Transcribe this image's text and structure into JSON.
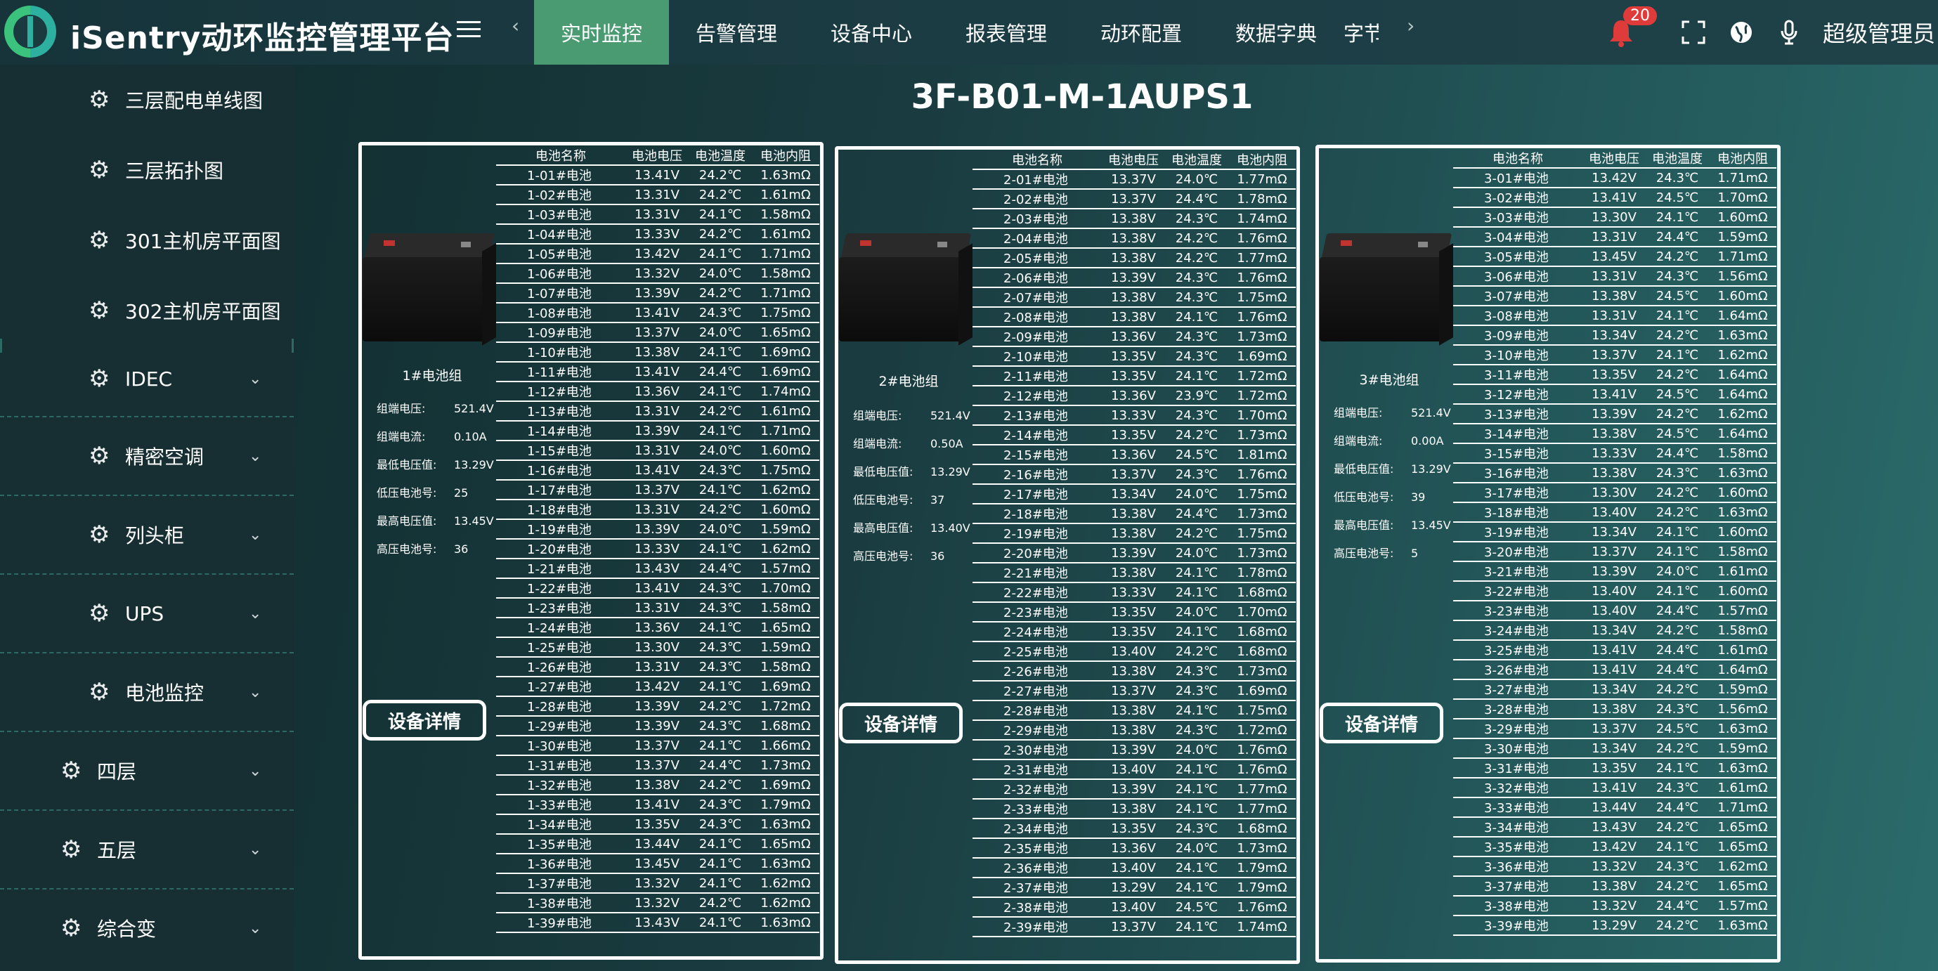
{
  "app": {
    "title": "iSentry动环监控管理平台"
  },
  "nav": {
    "tabs": [
      "实时监控",
      "告警管理",
      "设备中心",
      "报表管理",
      "动环配置",
      "数据字典",
      "字节"
    ],
    "prev": "‹",
    "next": "›"
  },
  "header": {
    "alarm_count": "20",
    "user": "超级管理员"
  },
  "sidebar": {
    "items": [
      {
        "label": "三层配电单线图",
        "expandable": false,
        "level": 2
      },
      {
        "label": "三层拓扑图",
        "expandable": false,
        "level": 2
      },
      {
        "label": "301主机房平面图",
        "expandable": false,
        "level": 2
      },
      {
        "label": "302主机房平面图",
        "expandable": false,
        "level": 2
      },
      {
        "label": "IDEC",
        "expandable": true,
        "level": 2
      },
      {
        "label": "精密空调",
        "expandable": true,
        "level": 2
      },
      {
        "label": "列头柜",
        "expandable": true,
        "level": 2
      },
      {
        "label": "UPS",
        "expandable": true,
        "level": 2
      },
      {
        "label": "电池监控",
        "expandable": true,
        "level": 2
      },
      {
        "label": "四层",
        "expandable": true,
        "level": 1
      },
      {
        "label": "五层",
        "expandable": true,
        "level": 1
      },
      {
        "label": "综合变",
        "expandable": true,
        "level": 1
      }
    ]
  },
  "page": {
    "title": "3F-B01-M-1AUPS1"
  },
  "table_headers": [
    "电池名称",
    "电池电压",
    "电池温度",
    "电池内阻"
  ],
  "detail_label": "设备详情",
  "groups": [
    {
      "name": "1#电池组",
      "info": [
        {
          "k": "组端电压:",
          "v": "521.4V"
        },
        {
          "k": "组端电流:",
          "v": "0.10A"
        },
        {
          "k": "最低电压值:",
          "v": "13.29V"
        },
        {
          "k": "低压电池号:",
          "v": "25"
        },
        {
          "k": "最高电压值:",
          "v": "13.45V"
        },
        {
          "k": "高压电池号:",
          "v": "36"
        }
      ],
      "rows": [
        [
          "1-01#电池",
          "13.41V",
          "24.2℃",
          "1.63mΩ"
        ],
        [
          "1-02#电池",
          "13.31V",
          "24.2℃",
          "1.61mΩ"
        ],
        [
          "1-03#电池",
          "13.31V",
          "24.1℃",
          "1.58mΩ"
        ],
        [
          "1-04#电池",
          "13.33V",
          "24.2℃",
          "1.61mΩ"
        ],
        [
          "1-05#电池",
          "13.42V",
          "24.1℃",
          "1.71mΩ"
        ],
        [
          "1-06#电池",
          "13.32V",
          "24.0℃",
          "1.58mΩ"
        ],
        [
          "1-07#电池",
          "13.39V",
          "24.2℃",
          "1.71mΩ"
        ],
        [
          "1-08#电池",
          "13.41V",
          "24.3℃",
          "1.75mΩ"
        ],
        [
          "1-09#电池",
          "13.37V",
          "24.0℃",
          "1.65mΩ"
        ],
        [
          "1-10#电池",
          "13.38V",
          "24.1℃",
          "1.69mΩ"
        ],
        [
          "1-11#电池",
          "13.41V",
          "24.4℃",
          "1.69mΩ"
        ],
        [
          "1-12#电池",
          "13.36V",
          "24.1℃",
          "1.74mΩ"
        ],
        [
          "1-13#电池",
          "13.31V",
          "24.2℃",
          "1.61mΩ"
        ],
        [
          "1-14#电池",
          "13.39V",
          "24.1℃",
          "1.71mΩ"
        ],
        [
          "1-15#电池",
          "13.31V",
          "24.0℃",
          "1.60mΩ"
        ],
        [
          "1-16#电池",
          "13.41V",
          "24.3℃",
          "1.75mΩ"
        ],
        [
          "1-17#电池",
          "13.37V",
          "24.1℃",
          "1.62mΩ"
        ],
        [
          "1-18#电池",
          "13.31V",
          "24.2℃",
          "1.60mΩ"
        ],
        [
          "1-19#电池",
          "13.39V",
          "24.0℃",
          "1.59mΩ"
        ],
        [
          "1-20#电池",
          "13.33V",
          "24.1℃",
          "1.62mΩ"
        ],
        [
          "1-21#电池",
          "13.43V",
          "24.4℃",
          "1.57mΩ"
        ],
        [
          "1-22#电池",
          "13.41V",
          "24.3℃",
          "1.70mΩ"
        ],
        [
          "1-23#电池",
          "13.31V",
          "24.3℃",
          "1.58mΩ"
        ],
        [
          "1-24#电池",
          "13.36V",
          "24.1℃",
          "1.65mΩ"
        ],
        [
          "1-25#电池",
          "13.30V",
          "24.3℃",
          "1.59mΩ"
        ],
        [
          "1-26#电池",
          "13.31V",
          "24.3℃",
          "1.58mΩ"
        ],
        [
          "1-27#电池",
          "13.42V",
          "24.1℃",
          "1.69mΩ"
        ],
        [
          "1-28#电池",
          "13.39V",
          "24.2℃",
          "1.72mΩ"
        ],
        [
          "1-29#电池",
          "13.39V",
          "24.3℃",
          "1.68mΩ"
        ],
        [
          "1-30#电池",
          "13.37V",
          "24.1℃",
          "1.66mΩ"
        ],
        [
          "1-31#电池",
          "13.37V",
          "24.4℃",
          "1.73mΩ"
        ],
        [
          "1-32#电池",
          "13.38V",
          "24.2℃",
          "1.69mΩ"
        ],
        [
          "1-33#电池",
          "13.41V",
          "24.3℃",
          "1.79mΩ"
        ],
        [
          "1-34#电池",
          "13.35V",
          "24.3℃",
          "1.63mΩ"
        ],
        [
          "1-35#电池",
          "13.44V",
          "24.1℃",
          "1.65mΩ"
        ],
        [
          "1-36#电池",
          "13.45V",
          "24.1℃",
          "1.63mΩ"
        ],
        [
          "1-37#电池",
          "13.32V",
          "24.1℃",
          "1.62mΩ"
        ],
        [
          "1-38#电池",
          "13.32V",
          "24.2℃",
          "1.62mΩ"
        ],
        [
          "1-39#电池",
          "13.43V",
          "24.1℃",
          "1.63mΩ"
        ]
      ]
    },
    {
      "name": "2#电池组",
      "info": [
        {
          "k": "组端电压:",
          "v": "521.4V"
        },
        {
          "k": "组端电流:",
          "v": "0.50A"
        },
        {
          "k": "最低电压值:",
          "v": "13.29V"
        },
        {
          "k": "低压电池号:",
          "v": "37"
        },
        {
          "k": "最高电压值:",
          "v": "13.40V"
        },
        {
          "k": "高压电池号:",
          "v": "36"
        }
      ],
      "rows": [
        [
          "2-01#电池",
          "13.37V",
          "24.0℃",
          "1.77mΩ"
        ],
        [
          "2-02#电池",
          "13.37V",
          "24.4℃",
          "1.78mΩ"
        ],
        [
          "2-03#电池",
          "13.38V",
          "24.3℃",
          "1.74mΩ"
        ],
        [
          "2-04#电池",
          "13.38V",
          "24.2℃",
          "1.76mΩ"
        ],
        [
          "2-05#电池",
          "13.38V",
          "24.2℃",
          "1.77mΩ"
        ],
        [
          "2-06#电池",
          "13.39V",
          "24.3℃",
          "1.76mΩ"
        ],
        [
          "2-07#电池",
          "13.38V",
          "24.3℃",
          "1.75mΩ"
        ],
        [
          "2-08#电池",
          "13.38V",
          "24.1℃",
          "1.76mΩ"
        ],
        [
          "2-09#电池",
          "13.36V",
          "24.3℃",
          "1.73mΩ"
        ],
        [
          "2-10#电池",
          "13.35V",
          "24.3℃",
          "1.69mΩ"
        ],
        [
          "2-11#电池",
          "13.35V",
          "24.1℃",
          "1.72mΩ"
        ],
        [
          "2-12#电池",
          "13.36V",
          "23.9℃",
          "1.72mΩ"
        ],
        [
          "2-13#电池",
          "13.33V",
          "24.3℃",
          "1.70mΩ"
        ],
        [
          "2-14#电池",
          "13.35V",
          "24.2℃",
          "1.73mΩ"
        ],
        [
          "2-15#电池",
          "13.36V",
          "24.5℃",
          "1.81mΩ"
        ],
        [
          "2-16#电池",
          "13.37V",
          "24.3℃",
          "1.76mΩ"
        ],
        [
          "2-17#电池",
          "13.34V",
          "24.0℃",
          "1.75mΩ"
        ],
        [
          "2-18#电池",
          "13.38V",
          "24.4℃",
          "1.73mΩ"
        ],
        [
          "2-19#电池",
          "13.38V",
          "24.2℃",
          "1.75mΩ"
        ],
        [
          "2-20#电池",
          "13.39V",
          "24.0℃",
          "1.73mΩ"
        ],
        [
          "2-21#电池",
          "13.38V",
          "24.1℃",
          "1.78mΩ"
        ],
        [
          "2-22#电池",
          "13.33V",
          "24.1℃",
          "1.68mΩ"
        ],
        [
          "2-23#电池",
          "13.35V",
          "24.0℃",
          "1.70mΩ"
        ],
        [
          "2-24#电池",
          "13.35V",
          "24.1℃",
          "1.68mΩ"
        ],
        [
          "2-25#电池",
          "13.40V",
          "24.2℃",
          "1.68mΩ"
        ],
        [
          "2-26#电池",
          "13.38V",
          "24.3℃",
          "1.73mΩ"
        ],
        [
          "2-27#电池",
          "13.37V",
          "24.3℃",
          "1.69mΩ"
        ],
        [
          "2-28#电池",
          "13.38V",
          "24.1℃",
          "1.75mΩ"
        ],
        [
          "2-29#电池",
          "13.38V",
          "24.3℃",
          "1.72mΩ"
        ],
        [
          "2-30#电池",
          "13.39V",
          "24.0℃",
          "1.76mΩ"
        ],
        [
          "2-31#电池",
          "13.40V",
          "24.1℃",
          "1.76mΩ"
        ],
        [
          "2-32#电池",
          "13.39V",
          "24.1℃",
          "1.77mΩ"
        ],
        [
          "2-33#电池",
          "13.38V",
          "24.1℃",
          "1.77mΩ"
        ],
        [
          "2-34#电池",
          "13.35V",
          "24.3℃",
          "1.68mΩ"
        ],
        [
          "2-35#电池",
          "13.36V",
          "24.0℃",
          "1.73mΩ"
        ],
        [
          "2-36#电池",
          "13.40V",
          "24.1℃",
          "1.79mΩ"
        ],
        [
          "2-37#电池",
          "13.29V",
          "24.1℃",
          "1.79mΩ"
        ],
        [
          "2-38#电池",
          "13.40V",
          "24.5℃",
          "1.76mΩ"
        ],
        [
          "2-39#电池",
          "13.37V",
          "24.1℃",
          "1.74mΩ"
        ]
      ]
    },
    {
      "name": "3#电池组",
      "info": [
        {
          "k": "组端电压:",
          "v": "521.4V"
        },
        {
          "k": "组端电流:",
          "v": "0.00A"
        },
        {
          "k": "最低电压值:",
          "v": "13.29V"
        },
        {
          "k": "低压电池号:",
          "v": "39"
        },
        {
          "k": "最高电压值:",
          "v": "13.45V"
        },
        {
          "k": "高压电池号:",
          "v": "5"
        }
      ],
      "rows": [
        [
          "3-01#电池",
          "13.42V",
          "24.3℃",
          "1.71mΩ"
        ],
        [
          "3-02#电池",
          "13.41V",
          "24.5℃",
          "1.70mΩ"
        ],
        [
          "3-03#电池",
          "13.30V",
          "24.1℃",
          "1.60mΩ"
        ],
        [
          "3-04#电池",
          "13.31V",
          "24.4℃",
          "1.59mΩ"
        ],
        [
          "3-05#电池",
          "13.45V",
          "24.2℃",
          "1.71mΩ"
        ],
        [
          "3-06#电池",
          "13.31V",
          "24.3℃",
          "1.56mΩ"
        ],
        [
          "3-07#电池",
          "13.38V",
          "24.5℃",
          "1.60mΩ"
        ],
        [
          "3-08#电池",
          "13.31V",
          "24.1℃",
          "1.64mΩ"
        ],
        [
          "3-09#电池",
          "13.34V",
          "24.2℃",
          "1.63mΩ"
        ],
        [
          "3-10#电池",
          "13.37V",
          "24.1℃",
          "1.62mΩ"
        ],
        [
          "3-11#电池",
          "13.35V",
          "24.2℃",
          "1.64mΩ"
        ],
        [
          "3-12#电池",
          "13.41V",
          "24.5℃",
          "1.64mΩ"
        ],
        [
          "3-13#电池",
          "13.39V",
          "24.2℃",
          "1.62mΩ"
        ],
        [
          "3-14#电池",
          "13.38V",
          "24.5℃",
          "1.64mΩ"
        ],
        [
          "3-15#电池",
          "13.33V",
          "24.4℃",
          "1.58mΩ"
        ],
        [
          "3-16#电池",
          "13.38V",
          "24.3℃",
          "1.63mΩ"
        ],
        [
          "3-17#电池",
          "13.30V",
          "24.2℃",
          "1.60mΩ"
        ],
        [
          "3-18#电池",
          "13.40V",
          "24.2℃",
          "1.63mΩ"
        ],
        [
          "3-19#电池",
          "13.34V",
          "24.1℃",
          "1.60mΩ"
        ],
        [
          "3-20#电池",
          "13.37V",
          "24.1℃",
          "1.58mΩ"
        ],
        [
          "3-21#电池",
          "13.39V",
          "24.0℃",
          "1.61mΩ"
        ],
        [
          "3-22#电池",
          "13.40V",
          "24.1℃",
          "1.60mΩ"
        ],
        [
          "3-23#电池",
          "13.40V",
          "24.4℃",
          "1.57mΩ"
        ],
        [
          "3-24#电池",
          "13.34V",
          "24.2℃",
          "1.58mΩ"
        ],
        [
          "3-25#电池",
          "13.41V",
          "24.4℃",
          "1.61mΩ"
        ],
        [
          "3-26#电池",
          "13.41V",
          "24.4℃",
          "1.64mΩ"
        ],
        [
          "3-27#电池",
          "13.34V",
          "24.2℃",
          "1.59mΩ"
        ],
        [
          "3-28#电池",
          "13.38V",
          "24.3℃",
          "1.56mΩ"
        ],
        [
          "3-29#电池",
          "13.37V",
          "24.5℃",
          "1.63mΩ"
        ],
        [
          "3-30#电池",
          "13.34V",
          "24.2℃",
          "1.59mΩ"
        ],
        [
          "3-31#电池",
          "13.35V",
          "24.1℃",
          "1.63mΩ"
        ],
        [
          "3-32#电池",
          "13.41V",
          "24.3℃",
          "1.61mΩ"
        ],
        [
          "3-33#电池",
          "13.44V",
          "24.4℃",
          "1.71mΩ"
        ],
        [
          "3-34#电池",
          "13.43V",
          "24.2℃",
          "1.65mΩ"
        ],
        [
          "3-35#电池",
          "13.42V",
          "24.1℃",
          "1.65mΩ"
        ],
        [
          "3-36#电池",
          "13.32V",
          "24.3℃",
          "1.62mΩ"
        ],
        [
          "3-37#电池",
          "13.38V",
          "24.2℃",
          "1.65mΩ"
        ],
        [
          "3-38#电池",
          "13.32V",
          "24.4℃",
          "1.57mΩ"
        ],
        [
          "3-39#电池",
          "13.29V",
          "24.2℃",
          "1.63mΩ"
        ]
      ]
    }
  ]
}
